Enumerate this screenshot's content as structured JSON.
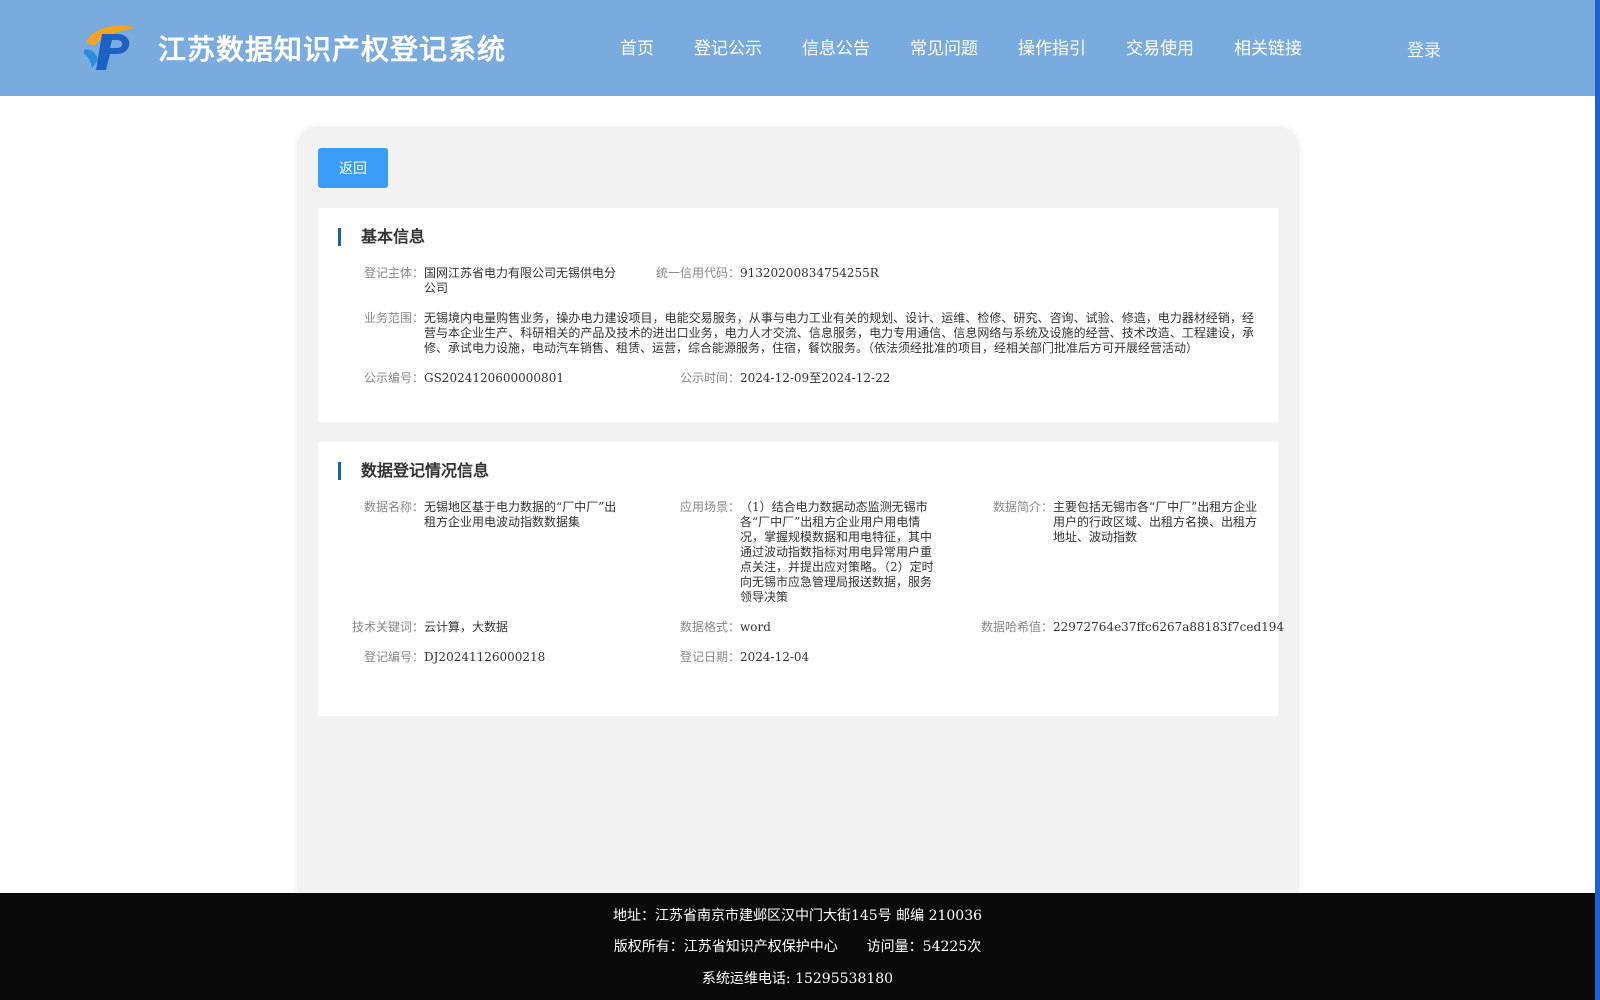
{
  "header": {
    "title": "江苏数据知识产权登记系统",
    "nav": [
      "首页",
      "登记公示",
      "信息公告",
      "常见问题",
      "操作指引",
      "交易使用",
      "相关链接"
    ],
    "login": "登录"
  },
  "back_label": "返回",
  "basic": {
    "section_title": "基本信息",
    "subject_label": "登记主体：",
    "subject": "国网江苏省电力有限公司无锡供电分公司",
    "credit_label": "统一信用代码：",
    "credit": "91320200834754255R",
    "scope_label": "业务范围：",
    "scope": "无锡境内电量购售业务，操办电力建设项目，电能交易服务，从事与电力工业有关的规划、设计、运维、检修、研究、咨询、试验、修造，电力器材经销，经营与本企业生产、科研相关的产品及技术的进出口业务，电力人才交流、信息服务，电力专用通信、信息网络与系统及设施的经营、技术改造、工程建设，承修、承试电力设施，电动汽车销售、租赁、运营，综合能源服务，住宿，餐饮服务。（依法须经批准的项目，经相关部门批准后方可开展经营活动）",
    "pub_no_label": "公示编号：",
    "pub_no": "GS2024120600000801",
    "pub_time_label": "公示时间：",
    "pub_time": "2024-12-09至2024-12-22"
  },
  "data_reg": {
    "section_title": "数据登记情况信息",
    "name_label": "数据名称：",
    "name": "无锡地区基于电力数据的“厂中厂”出租方企业用电波动指数数据集",
    "scene_label": "应用场景：",
    "scene": "（1）结合电力数据动态监测无锡市各“厂中厂”出租方企业用户用电情况，掌握规模数据和用电特征，其中通过波动指数指标对用电异常用户重点关注，并提出应对策略。（2）定时向无锡市应急管理局报送数据，服务领导决策",
    "intro_label": "数据简介：",
    "intro": "主要包括无锡市各“厂中厂”出租方企业用户的行政区域、出租方名换、出租方地址、波动指数",
    "keywords_label": "技术关键词：",
    "keywords": "云计算，大数据",
    "format_label": "数据格式：",
    "format": "word",
    "hash_label": "数据哈希值：",
    "hash": "22972764e37ffc6267a88183f7ced194",
    "reg_no_label": "登记编号：",
    "reg_no": "DJ20241126000218",
    "reg_date_label": "登记日期：",
    "reg_date": "2024-12-04"
  },
  "footer": {
    "address": "地址：江苏省南京市建邺区汉中门大街145号 邮编 210036",
    "copyright": "版权所有：江苏省知识产权保护中心",
    "visits": "访问量：54225次",
    "phone": "系统运维电话: 15295538180"
  },
  "colors": {
    "header_bg": "#7aabde",
    "button": "#3b9cf6",
    "section_bar": "#1e5fa8",
    "footer_bg": "#0a0a0a"
  }
}
